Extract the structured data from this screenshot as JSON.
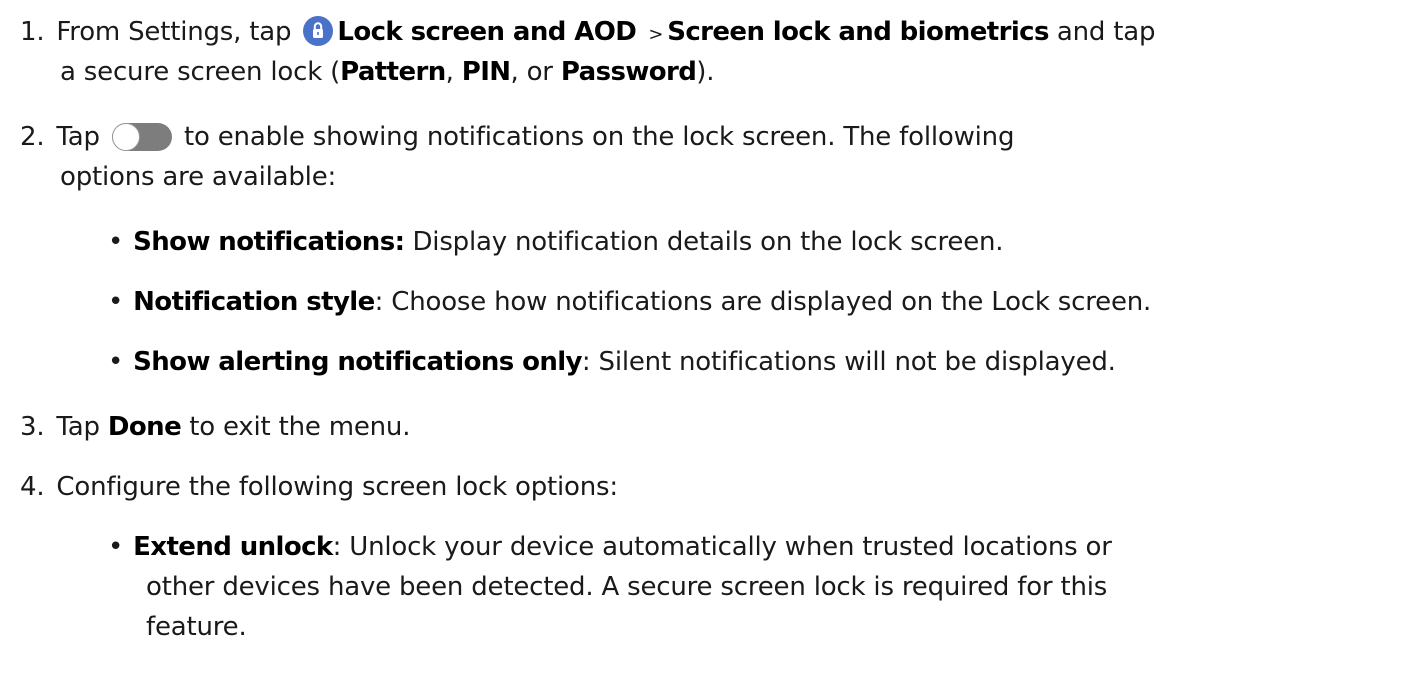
{
  "steps": {
    "s1": {
      "num": "1.",
      "a1": "From Settings, tap",
      "b1": "Lock screen and AOD",
      "sep": ">",
      "b2": "Screen lock and biometrics",
      "a2": "and tap",
      "a3": "a secure screen lock (",
      "b3": "Pattern",
      "a4": ",",
      "b4": "PIN",
      "a5": ", or",
      "b5": "Password",
      "a6": ")."
    },
    "s2": {
      "num": "2.",
      "a1": "Tap",
      "a2": "to enable showing notifications on the lock screen. The following",
      "a3": "options are available:",
      "bullets": [
        {
          "label": "Show notifications:",
          "text": "Display notification details on the lock screen."
        },
        {
          "label": "Notification style",
          "text": ": Choose how notifications are displayed on the Lock screen."
        },
        {
          "label": "Show alerting notifications only",
          "text": ": Silent notifications will not be displayed."
        }
      ]
    },
    "s3": {
      "num": "3.",
      "a1": "Tap",
      "b1": "Done",
      "a2": "to exit the menu."
    },
    "s4": {
      "num": "4.",
      "a1": "Configure the following screen lock options:",
      "bullet": {
        "label": "Extend unlock",
        "l1": ": Unlock your device automatically when trusted locations or",
        "l2": "other devices have been detected. A secure screen lock is required for this",
        "l3": "feature."
      }
    }
  },
  "icons": {
    "lock": "lock-icon",
    "toggle": "toggle-switch-icon",
    "bullet": "•",
    "lock_color": "#4a72c9",
    "toggle_color": "#7d7d7d"
  }
}
